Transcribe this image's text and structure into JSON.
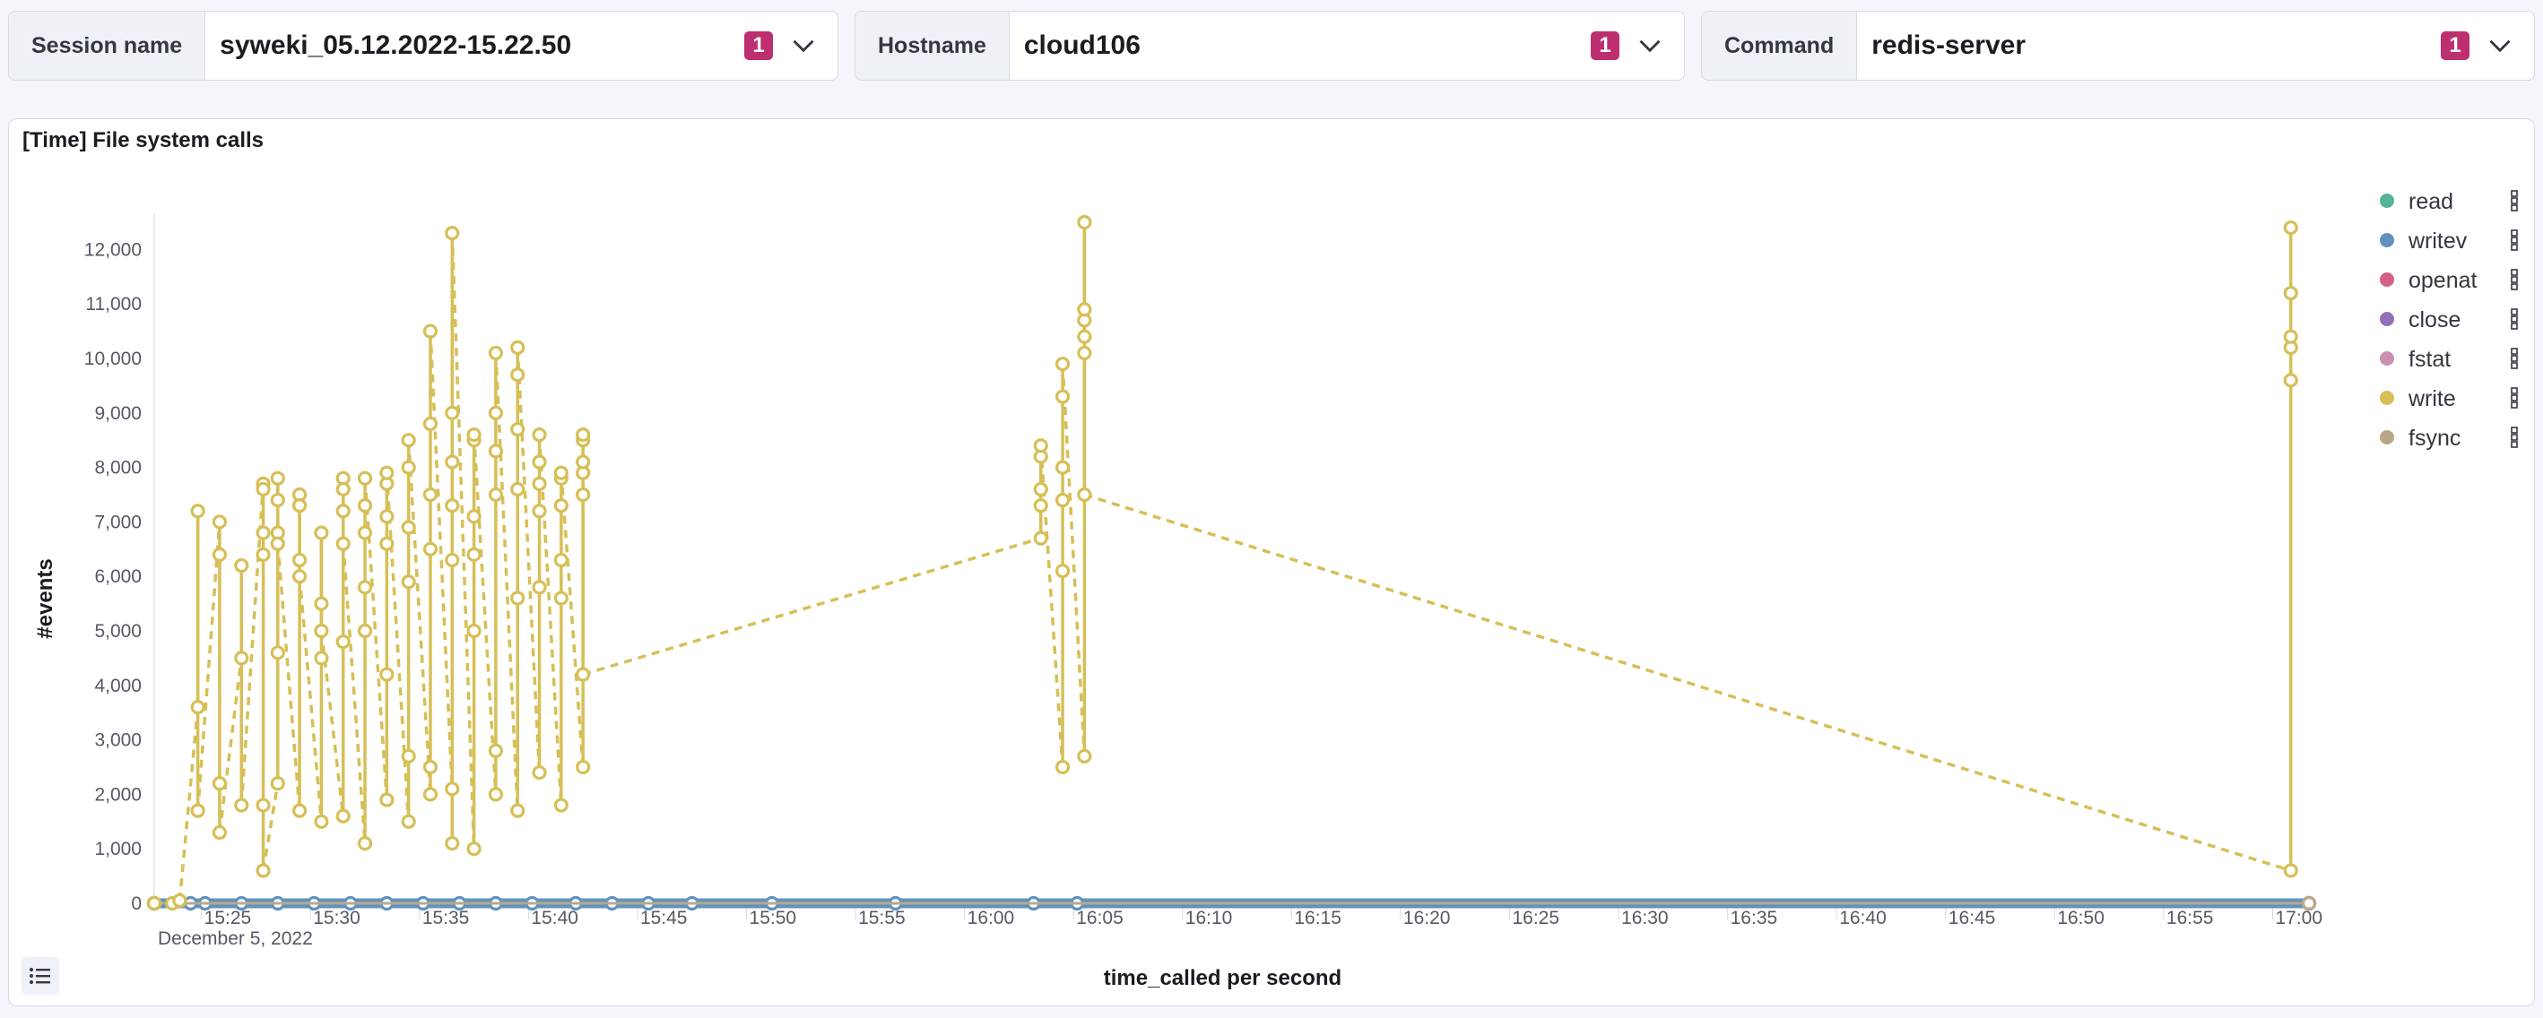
{
  "filters": [
    {
      "label": "Session name",
      "value": "syweki_05.12.2022-15.22.50",
      "count": "1"
    },
    {
      "label": "Hostname",
      "value": "cloud106",
      "count": "1"
    },
    {
      "label": "Command",
      "value": "redis-server",
      "count": "1"
    }
  ],
  "panel": {
    "title": "[Time] File system calls"
  },
  "colors": {
    "badge": "#bd2f6e",
    "write": "#d6bf57",
    "writev": "#6092c0"
  },
  "chart_data": {
    "type": "line",
    "title": "[Time] File system calls",
    "xlabel": "time_called per second",
    "ylabel": "#events",
    "date_label": "December 5, 2022",
    "ylim": [
      0,
      12500
    ],
    "xlim": [
      "15:22:50",
      "17:01:40"
    ],
    "yticks": [
      "0",
      "1,000",
      "2,000",
      "3,000",
      "4,000",
      "5,000",
      "6,000",
      "7,000",
      "8,000",
      "9,000",
      "10,000",
      "11,000",
      "12,000"
    ],
    "xticks": [
      "15:25",
      "15:30",
      "15:35",
      "15:40",
      "15:45",
      "15:50",
      "15:55",
      "16:00",
      "16:05",
      "16:10",
      "16:15",
      "16:20",
      "16:25",
      "16:30",
      "16:35",
      "16:40",
      "16:45",
      "16:50",
      "16:55",
      "17:00"
    ],
    "legend_position": "right",
    "grid": false,
    "series": [
      {
        "name": "read",
        "color": "#54b399",
        "values": [
          [
            "15:22:50",
            0
          ],
          [
            "17:01:40",
            0
          ]
        ]
      },
      {
        "name": "writev",
        "color": "#6092c0",
        "values": [
          [
            "15:22:50",
            0
          ],
          [
            "15:24:30",
            0
          ],
          [
            "15:25:10",
            0
          ],
          [
            "15:26:50",
            0
          ],
          [
            "15:28:30",
            0
          ],
          [
            "15:30:10",
            0
          ],
          [
            "15:31:50",
            0
          ],
          [
            "15:33:30",
            0
          ],
          [
            "15:35:10",
            0
          ],
          [
            "15:36:50",
            0
          ],
          [
            "15:38:30",
            0
          ],
          [
            "15:40:10",
            0
          ],
          [
            "15:42:10",
            0
          ],
          [
            "15:43:50",
            0
          ],
          [
            "15:45:30",
            0
          ],
          [
            "15:47:30",
            0
          ],
          [
            "15:51:10",
            0
          ],
          [
            "15:56:50",
            0
          ],
          [
            "16:03:10",
            0
          ],
          [
            "16:05:10",
            0
          ],
          [
            "17:01:40",
            0
          ]
        ]
      },
      {
        "name": "openat",
        "color": "#d36086",
        "values": [
          [
            "15:22:50",
            0
          ],
          [
            "17:01:40",
            0
          ]
        ]
      },
      {
        "name": "close",
        "color": "#9170b8",
        "values": [
          [
            "15:22:50",
            0
          ],
          [
            "17:01:40",
            0
          ]
        ]
      },
      {
        "name": "fstat",
        "color": "#ca8eae",
        "values": [
          [
            "15:22:50",
            0
          ],
          [
            "17:01:40",
            0
          ]
        ]
      },
      {
        "name": "write",
        "color": "#d6bf57",
        "values": [
          [
            "15:22:50",
            0
          ],
          [
            "15:23:40",
            0
          ],
          [
            "15:24:00",
            50
          ],
          [
            "15:24:50",
            3600
          ],
          [
            "15:24:50",
            7200
          ],
          [
            "15:24:50",
            1700
          ],
          [
            "15:25:50",
            7000
          ],
          [
            "15:25:50",
            6400
          ],
          [
            "15:25:50",
            2200
          ],
          [
            "15:25:50",
            1300
          ],
          [
            "15:26:50",
            4500
          ],
          [
            "15:26:50",
            6200
          ],
          [
            "15:26:50",
            1800
          ],
          [
            "15:27:50",
            7700
          ],
          [
            "15:27:50",
            7600
          ],
          [
            "15:27:50",
            6800
          ],
          [
            "15:27:50",
            6400
          ],
          [
            "15:27:50",
            1800
          ],
          [
            "15:27:50",
            600
          ],
          [
            "15:28:30",
            2200
          ],
          [
            "15:28:30",
            4600
          ],
          [
            "15:28:30",
            7800
          ],
          [
            "15:28:30",
            7400
          ],
          [
            "15:28:30",
            6800
          ],
          [
            "15:28:30",
            6600
          ],
          [
            "15:29:30",
            1700
          ],
          [
            "15:29:30",
            7500
          ],
          [
            "15:29:30",
            7300
          ],
          [
            "15:29:30",
            6300
          ],
          [
            "15:29:30",
            6000
          ],
          [
            "15:30:30",
            1500
          ],
          [
            "15:30:30",
            4500
          ],
          [
            "15:30:30",
            5500
          ],
          [
            "15:30:30",
            6800
          ],
          [
            "15:30:30",
            5000
          ],
          [
            "15:31:30",
            1600
          ],
          [
            "15:31:30",
            4800
          ],
          [
            "15:31:30",
            7800
          ],
          [
            "15:31:30",
            7600
          ],
          [
            "15:31:30",
            7200
          ],
          [
            "15:31:30",
            6600
          ],
          [
            "15:32:30",
            1100
          ],
          [
            "15:32:30",
            5000
          ],
          [
            "15:32:30",
            5800
          ],
          [
            "15:32:30",
            6800
          ],
          [
            "15:32:30",
            7300
          ],
          [
            "15:32:30",
            7800
          ],
          [
            "15:33:30",
            1900
          ],
          [
            "15:33:30",
            4200
          ],
          [
            "15:33:30",
            6600
          ],
          [
            "15:33:30",
            7100
          ],
          [
            "15:33:30",
            7700
          ],
          [
            "15:33:30",
            7900
          ],
          [
            "15:34:30",
            1500
          ],
          [
            "15:34:30",
            2700
          ],
          [
            "15:34:30",
            5900
          ],
          [
            "15:34:30",
            6900
          ],
          [
            "15:34:30",
            8000
          ],
          [
            "15:34:30",
            8500
          ],
          [
            "15:35:30",
            2000
          ],
          [
            "15:35:30",
            2500
          ],
          [
            "15:35:30",
            6500
          ],
          [
            "15:35:30",
            7500
          ],
          [
            "15:35:30",
            8800
          ],
          [
            "15:35:30",
            10500
          ],
          [
            "15:36:30",
            2100
          ],
          [
            "15:36:30",
            1100
          ],
          [
            "15:36:30",
            6300
          ],
          [
            "15:36:30",
            7300
          ],
          [
            "15:36:30",
            8100
          ],
          [
            "15:36:30",
            9000
          ],
          [
            "15:36:30",
            12300
          ],
          [
            "15:37:30",
            1000
          ],
          [
            "15:37:30",
            5000
          ],
          [
            "15:37:30",
            6400
          ],
          [
            "15:37:30",
            7100
          ],
          [
            "15:37:30",
            8500
          ],
          [
            "15:37:30",
            8600
          ],
          [
            "15:38:30",
            2000
          ],
          [
            "15:38:30",
            2800
          ],
          [
            "15:38:30",
            7500
          ],
          [
            "15:38:30",
            8300
          ],
          [
            "15:38:30",
            9000
          ],
          [
            "15:38:30",
            10100
          ],
          [
            "15:39:30",
            1700
          ],
          [
            "15:39:30",
            5600
          ],
          [
            "15:39:30",
            7600
          ],
          [
            "15:39:30",
            8700
          ],
          [
            "15:39:30",
            9700
          ],
          [
            "15:39:30",
            10200
          ],
          [
            "15:40:30",
            2400
          ],
          [
            "15:40:30",
            5800
          ],
          [
            "15:40:30",
            7200
          ],
          [
            "15:40:30",
            7700
          ],
          [
            "15:40:30",
            8100
          ],
          [
            "15:40:30",
            8600
          ],
          [
            "15:41:30",
            1800
          ],
          [
            "15:41:30",
            5600
          ],
          [
            "15:41:30",
            6300
          ],
          [
            "15:41:30",
            7300
          ],
          [
            "15:41:30",
            7800
          ],
          [
            "15:41:30",
            7900
          ],
          [
            "15:42:30",
            2500
          ],
          [
            "15:42:30",
            7500
          ],
          [
            "15:42:30",
            7900
          ],
          [
            "15:42:30",
            8100
          ],
          [
            "15:42:30",
            8500
          ],
          [
            "15:42:30",
            8600
          ],
          [
            "15:42:30",
            4200
          ],
          [
            "16:03:30",
            6700
          ],
          [
            "16:03:30",
            7300
          ],
          [
            "16:03:30",
            7600
          ],
          [
            "16:03:30",
            8200
          ],
          [
            "16:03:30",
            8400
          ],
          [
            "16:04:30",
            2500
          ],
          [
            "16:04:30",
            6100
          ],
          [
            "16:04:30",
            7400
          ],
          [
            "16:04:30",
            8000
          ],
          [
            "16:04:30",
            9300
          ],
          [
            "16:04:30",
            9900
          ],
          [
            "16:05:30",
            2700
          ],
          [
            "16:05:30",
            10100
          ],
          [
            "16:05:30",
            10400
          ],
          [
            "16:05:30",
            10700
          ],
          [
            "16:05:30",
            10900
          ],
          [
            "16:05:30",
            12500
          ],
          [
            "16:05:30",
            7500
          ],
          [
            "17:00:50",
            600
          ],
          [
            "17:00:50",
            9600
          ],
          [
            "17:00:50",
            10200
          ],
          [
            "17:00:50",
            10400
          ],
          [
            "17:00:50",
            11200
          ],
          [
            "17:00:50",
            12400
          ]
        ]
      },
      {
        "name": "fsync",
        "color": "#b9a888",
        "values": [
          [
            "15:22:50",
            0
          ],
          [
            "17:01:40",
            0
          ]
        ]
      }
    ]
  }
}
